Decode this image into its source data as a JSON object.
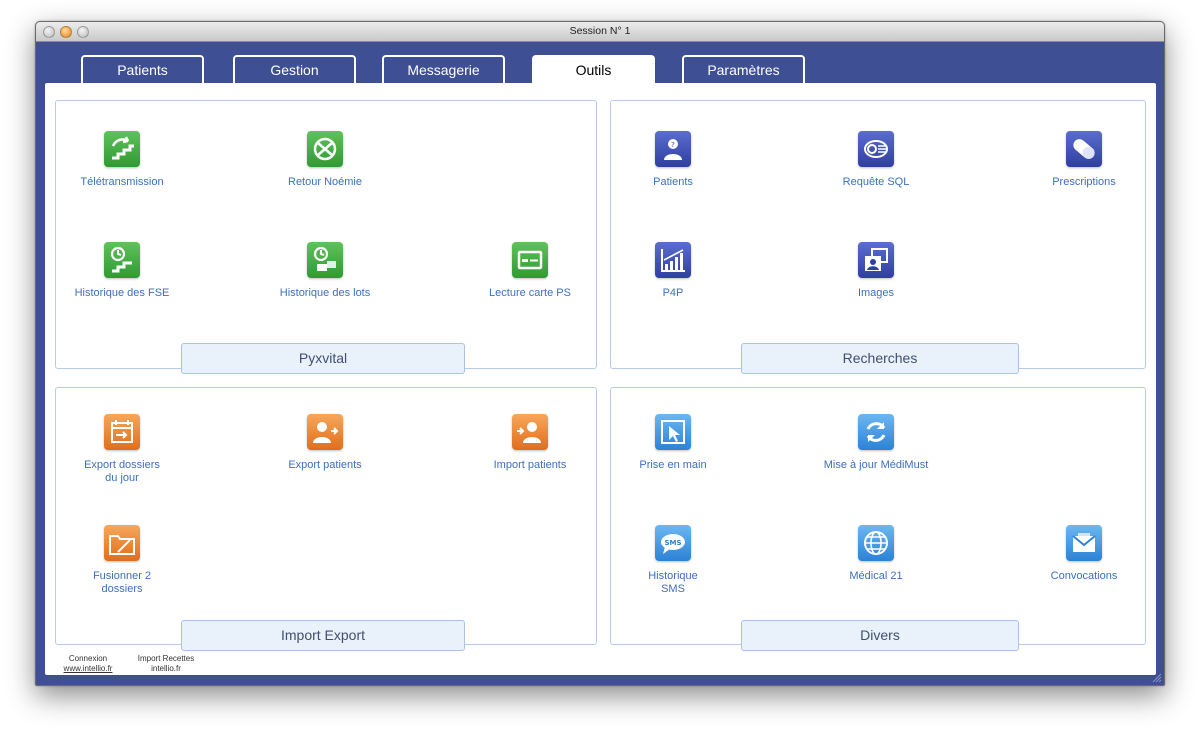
{
  "window": {
    "title": "Session N° 1"
  },
  "tabs": [
    {
      "label": "Patients",
      "active": false
    },
    {
      "label": "Gestion",
      "active": false
    },
    {
      "label": "Messagerie",
      "active": false
    },
    {
      "label": "Outils",
      "active": true
    },
    {
      "label": "Paramètres",
      "active": false
    }
  ],
  "panels": {
    "pyxvital": {
      "title": "Pyxvital",
      "items": [
        {
          "label": "Télétransmission",
          "icon": "teletransmission-icon"
        },
        {
          "label": "Retour Noémie",
          "icon": "noemie-return-icon"
        },
        {
          "label": "Historique des FSE",
          "icon": "fse-history-icon"
        },
        {
          "label": "Historique des lots",
          "icon": "batch-history-icon"
        },
        {
          "label": "Lecture carte PS",
          "icon": "ps-card-reader-icon"
        }
      ]
    },
    "recherches": {
      "title": "Recherches",
      "items": [
        {
          "label": "Patients",
          "icon": "patient-search-icon"
        },
        {
          "label": "Requête SQL",
          "icon": "sql-query-icon"
        },
        {
          "label": "Prescriptions",
          "icon": "pill-icon"
        },
        {
          "label": "P4P",
          "icon": "chart-icon"
        },
        {
          "label": "Images",
          "icon": "images-icon"
        }
      ]
    },
    "import_export": {
      "title": "Import Export",
      "items": [
        {
          "label": "Export dossiers\ndu jour",
          "icon": "calendar-export-icon"
        },
        {
          "label": "Export patients",
          "icon": "user-export-icon"
        },
        {
          "label": "Import patients",
          "icon": "user-import-icon"
        },
        {
          "label": "Fusionner 2\ndossiers",
          "icon": "merge-folder-icon"
        }
      ]
    },
    "divers": {
      "title": "Divers",
      "items": [
        {
          "label": "Prise en main",
          "icon": "remote-control-icon"
        },
        {
          "label": "Mise à jour MédiMust",
          "icon": "refresh-icon"
        },
        {
          "label": "Historique\nSMS",
          "icon": "sms-icon"
        },
        {
          "label": "Médical 21",
          "icon": "globe-icon"
        },
        {
          "label": "Convocations",
          "icon": "envelope-icon"
        }
      ]
    }
  },
  "footer": {
    "connexion": {
      "line1": "Connexion",
      "line2": "www.intellio.fr"
    },
    "import_recettes": {
      "line1": "Import Recettes",
      "line2": "intellio.fr"
    }
  }
}
